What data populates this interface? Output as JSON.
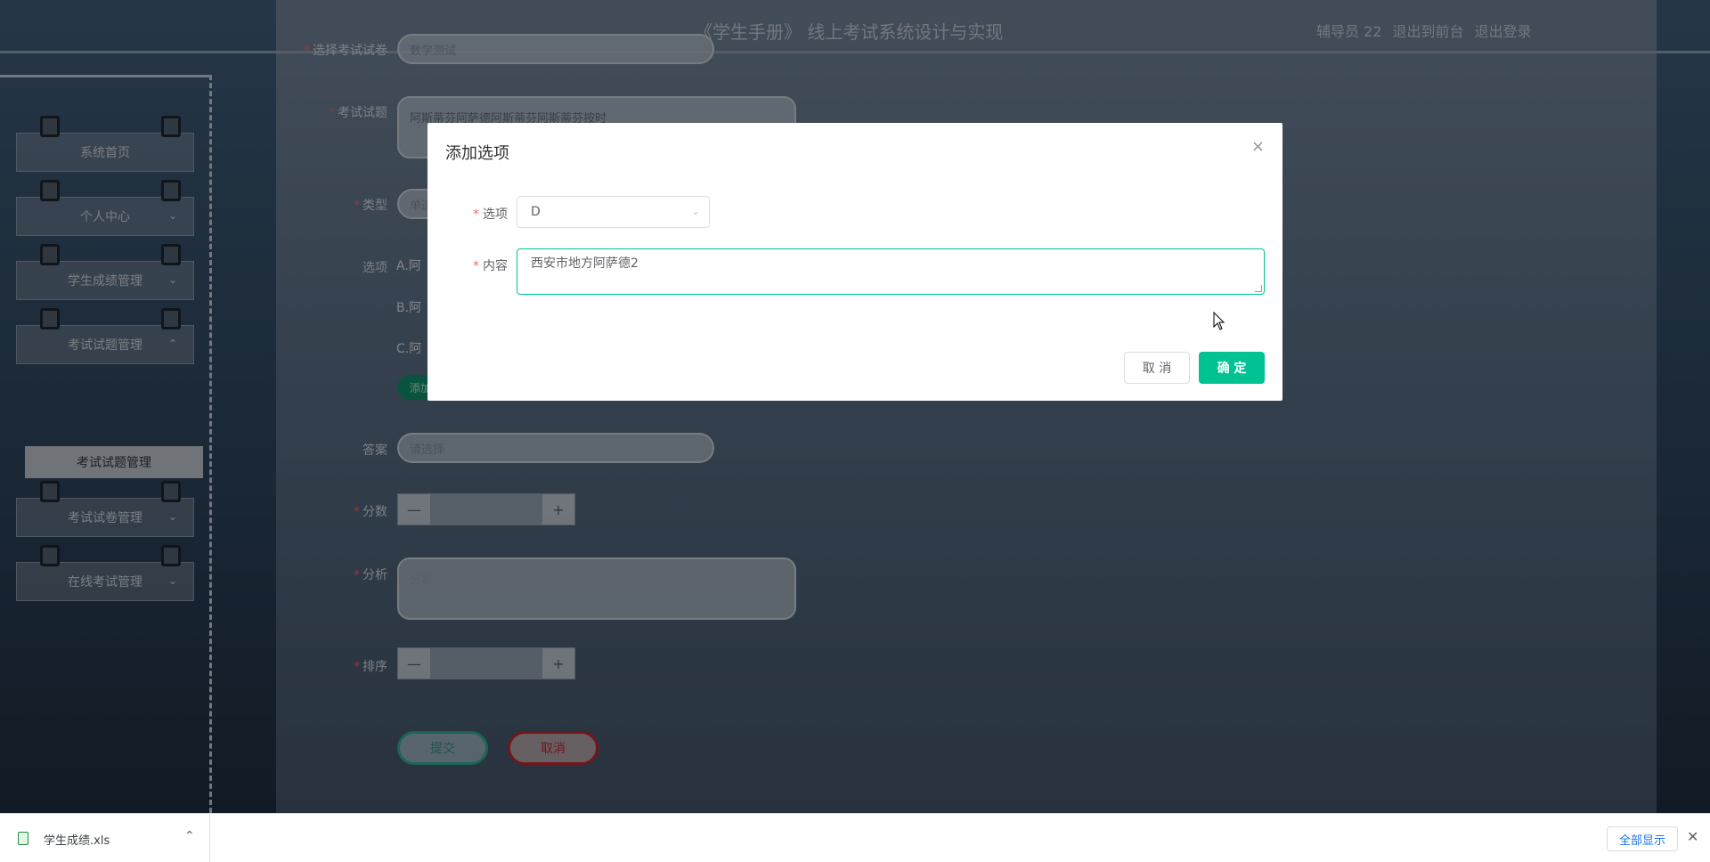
{
  "header": {
    "title": "《学生手册》 线上考试系统设计与实现",
    "user": "辅导员 22",
    "front_link": "退出到前台",
    "logout_link": "退出登录"
  },
  "sidebar": {
    "items": [
      {
        "label": "系统首页"
      },
      {
        "label": "个人中心"
      },
      {
        "label": "学生成绩管理"
      },
      {
        "label": "考试试题管理"
      },
      {
        "label": "考试试卷管理"
      },
      {
        "label": "在线考试管理"
      }
    ],
    "submenu_active": "考试试题管理"
  },
  "form": {
    "paper_label": "选择考试试卷",
    "paper_value": "数学测试",
    "question_label": "考试试题",
    "question_value": "阿斯蒂芬阿萨德阿斯蒂芬阿斯蒂芬按时",
    "type_label": "类型",
    "type_value": "单选",
    "options_label": "选项",
    "options": [
      "A.阿",
      "B.阿",
      "C.阿"
    ],
    "add_option_btn": "添加",
    "answer_label": "答案",
    "answer_placeholder": "请选择",
    "score_label": "分数",
    "analysis_label": "分析",
    "analysis_placeholder": "分析",
    "sort_label": "排序",
    "stepper_minus": "—",
    "stepper_plus": "+",
    "submit_btn": "提交",
    "cancel_btn": "取消"
  },
  "dialog": {
    "title": "添加选项",
    "close_icon": "×",
    "option_label": "选项",
    "option_value": "D",
    "content_label": "内容",
    "content_value": "西安市地方阿萨德2",
    "cancel_btn": "取 消",
    "confirm_btn": "确 定",
    "accent_color": "#00c292"
  },
  "download_bar": {
    "file_name": "学生成绩.xls",
    "show_all": "全部显示",
    "close_icon": "✕"
  }
}
